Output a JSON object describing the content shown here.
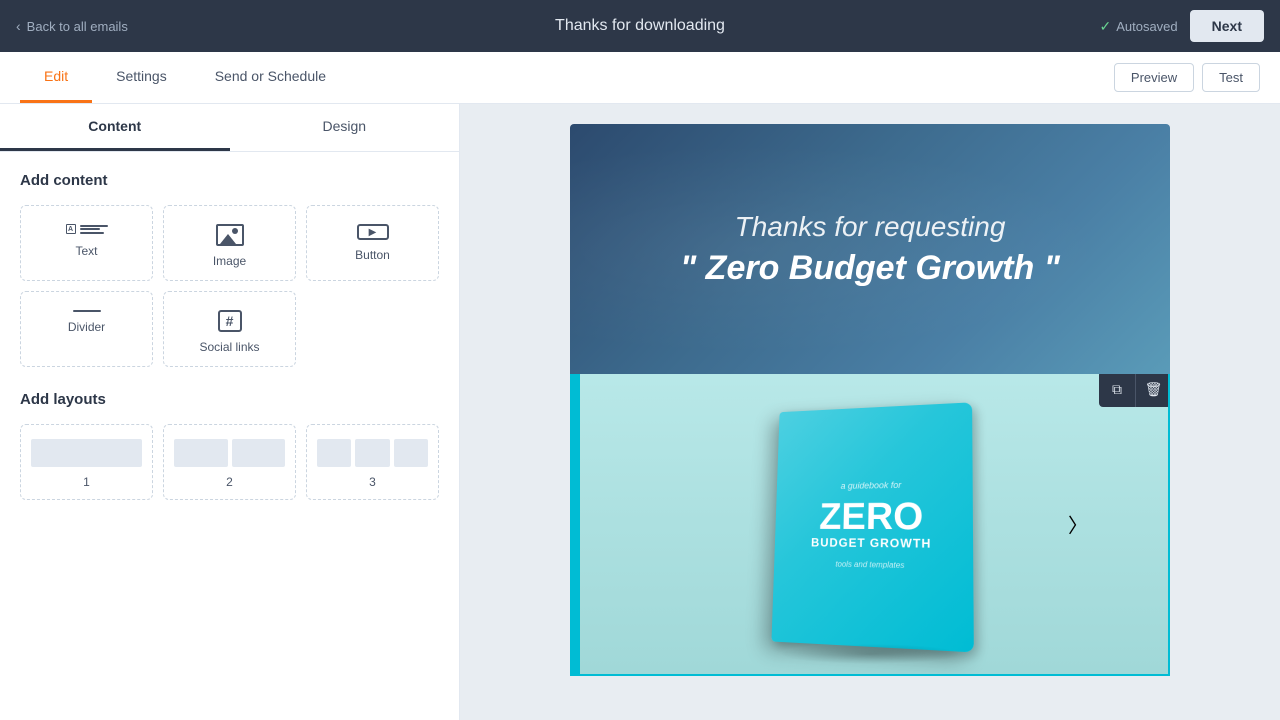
{
  "topNav": {
    "backLabel": "Back to all emails",
    "title": "Thanks for downloading",
    "autosaved": "Autosaved",
    "nextLabel": "Next"
  },
  "secondaryNav": {
    "tabs": [
      {
        "id": "edit",
        "label": "Edit",
        "active": true
      },
      {
        "id": "settings",
        "label": "Settings",
        "active": false
      },
      {
        "id": "send-or-schedule",
        "label": "Send or Schedule",
        "active": false
      }
    ],
    "actions": [
      {
        "id": "preview",
        "label": "Preview"
      },
      {
        "id": "test",
        "label": "Test"
      }
    ]
  },
  "leftPanel": {
    "tabs": [
      {
        "id": "content",
        "label": "Content",
        "active": true
      },
      {
        "id": "design",
        "label": "Design",
        "active": false
      }
    ],
    "addContent": {
      "title": "Add content",
      "items": [
        {
          "id": "text",
          "label": "Text",
          "icon": "text-icon"
        },
        {
          "id": "image",
          "label": "Image",
          "icon": "image-icon"
        },
        {
          "id": "button",
          "label": "Button",
          "icon": "button-icon"
        },
        {
          "id": "divider",
          "label": "Divider",
          "icon": "divider-icon"
        },
        {
          "id": "social-links",
          "label": "Social links",
          "icon": "social-icon"
        }
      ]
    },
    "addLayouts": {
      "title": "Add layouts",
      "items": [
        {
          "id": "layout-1",
          "label": "1",
          "columns": 1
        },
        {
          "id": "layout-2",
          "label": "2",
          "columns": 2
        },
        {
          "id": "layout-3",
          "label": "3",
          "columns": 3
        }
      ]
    }
  },
  "canvas": {
    "emailHeaderBlock": {
      "line1": "Thanks for requesting",
      "line2": "\" Zero Budget Growth \""
    },
    "bookBlock": {
      "tagline": "a guidebook for",
      "titleMain": "ZERO",
      "titleSub": "BUDGET GROWTH",
      "subtitle": "tools and templates"
    }
  },
  "floatToolbar": {
    "copyLabel": "copy",
    "deleteLabel": "delete"
  }
}
